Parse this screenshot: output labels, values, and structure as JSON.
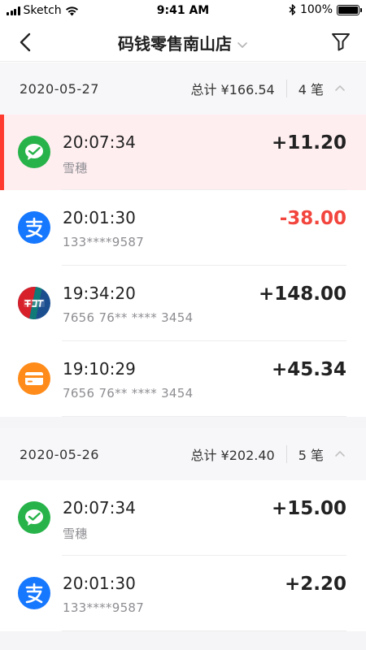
{
  "status_bar": {
    "carrier": "Sketch",
    "time": "9:41 AM",
    "battery": "100%",
    "battery_level": 1.0
  },
  "nav": {
    "title": "码钱零售南山店",
    "back_icon": "chevron-left-icon",
    "title_dropdown_icon": "chevron-down-icon",
    "filter_icon": "filter-icon"
  },
  "colors": {
    "wechat": "#27b34a",
    "alipay": "#1677ff",
    "unionpay_red": "#d7202a",
    "unionpay_blue": "#1b4e8f",
    "card": "#ff8c1a",
    "negative": "#f2453d",
    "highlight_bg": "#ffeef0",
    "highlight_bar": "#ff3b30"
  },
  "groups": [
    {
      "date": "2020-05-27",
      "total": "总计 ¥166.54",
      "count": "4 笔",
      "toggle_icon": "chevron-up-icon",
      "transactions": [
        {
          "method": "wechat",
          "icon": "wechat-pay-icon",
          "time": "20:07:34",
          "sub": "雪穗",
          "amount": "+11.20",
          "negative": false,
          "highlight": true
        },
        {
          "method": "alipay",
          "icon": "alipay-icon",
          "time": "20:01:30",
          "sub": "133****9587",
          "amount": "-38.00",
          "negative": true,
          "highlight": false
        },
        {
          "method": "unionpay",
          "icon": "unionpay-icon",
          "time": "19:34:20",
          "sub": "7656 76** **** 3454",
          "amount": "+148.00",
          "negative": false,
          "highlight": false
        },
        {
          "method": "card",
          "icon": "bank-card-icon",
          "time": "19:10:29",
          "sub": "7656 76** **** 3454",
          "amount": "+45.34",
          "negative": false,
          "highlight": false
        }
      ]
    },
    {
      "date": "2020-05-26",
      "total": "总计 ¥202.40",
      "count": "5 笔",
      "toggle_icon": "chevron-up-icon",
      "transactions": [
        {
          "method": "wechat",
          "icon": "wechat-pay-icon",
          "time": "20:07:34",
          "sub": "雪穗",
          "amount": "+15.00",
          "negative": false,
          "highlight": false
        },
        {
          "method": "alipay",
          "icon": "alipay-icon",
          "time": "20:01:30",
          "sub": "133****9587",
          "amount": "+2.20",
          "negative": false,
          "highlight": false
        }
      ]
    }
  ]
}
